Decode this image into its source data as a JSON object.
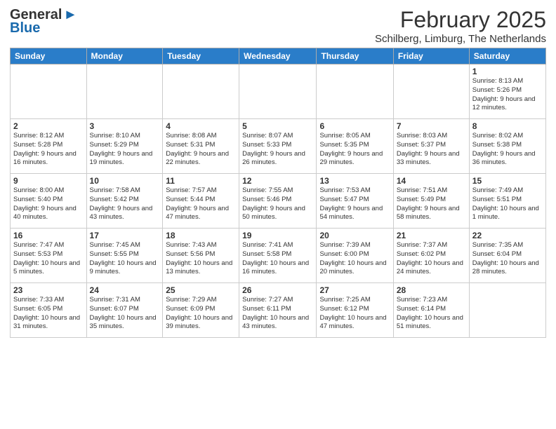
{
  "header": {
    "logo_general": "General",
    "logo_blue": "Blue",
    "title": "February 2025",
    "location": "Schilberg, Limburg, The Netherlands"
  },
  "weekdays": [
    "Sunday",
    "Monday",
    "Tuesday",
    "Wednesday",
    "Thursday",
    "Friday",
    "Saturday"
  ],
  "weeks": [
    [
      {
        "day": "",
        "info": ""
      },
      {
        "day": "",
        "info": ""
      },
      {
        "day": "",
        "info": ""
      },
      {
        "day": "",
        "info": ""
      },
      {
        "day": "",
        "info": ""
      },
      {
        "day": "",
        "info": ""
      },
      {
        "day": "1",
        "info": "Sunrise: 8:13 AM\nSunset: 5:26 PM\nDaylight: 9 hours and 12 minutes."
      }
    ],
    [
      {
        "day": "2",
        "info": "Sunrise: 8:12 AM\nSunset: 5:28 PM\nDaylight: 9 hours and 16 minutes."
      },
      {
        "day": "3",
        "info": "Sunrise: 8:10 AM\nSunset: 5:29 PM\nDaylight: 9 hours and 19 minutes."
      },
      {
        "day": "4",
        "info": "Sunrise: 8:08 AM\nSunset: 5:31 PM\nDaylight: 9 hours and 22 minutes."
      },
      {
        "day": "5",
        "info": "Sunrise: 8:07 AM\nSunset: 5:33 PM\nDaylight: 9 hours and 26 minutes."
      },
      {
        "day": "6",
        "info": "Sunrise: 8:05 AM\nSunset: 5:35 PM\nDaylight: 9 hours and 29 minutes."
      },
      {
        "day": "7",
        "info": "Sunrise: 8:03 AM\nSunset: 5:37 PM\nDaylight: 9 hours and 33 minutes."
      },
      {
        "day": "8",
        "info": "Sunrise: 8:02 AM\nSunset: 5:38 PM\nDaylight: 9 hours and 36 minutes."
      }
    ],
    [
      {
        "day": "9",
        "info": "Sunrise: 8:00 AM\nSunset: 5:40 PM\nDaylight: 9 hours and 40 minutes."
      },
      {
        "day": "10",
        "info": "Sunrise: 7:58 AM\nSunset: 5:42 PM\nDaylight: 9 hours and 43 minutes."
      },
      {
        "day": "11",
        "info": "Sunrise: 7:57 AM\nSunset: 5:44 PM\nDaylight: 9 hours and 47 minutes."
      },
      {
        "day": "12",
        "info": "Sunrise: 7:55 AM\nSunset: 5:46 PM\nDaylight: 9 hours and 50 minutes."
      },
      {
        "day": "13",
        "info": "Sunrise: 7:53 AM\nSunset: 5:47 PM\nDaylight: 9 hours and 54 minutes."
      },
      {
        "day": "14",
        "info": "Sunrise: 7:51 AM\nSunset: 5:49 PM\nDaylight: 9 hours and 58 minutes."
      },
      {
        "day": "15",
        "info": "Sunrise: 7:49 AM\nSunset: 5:51 PM\nDaylight: 10 hours and 1 minute."
      }
    ],
    [
      {
        "day": "16",
        "info": "Sunrise: 7:47 AM\nSunset: 5:53 PM\nDaylight: 10 hours and 5 minutes."
      },
      {
        "day": "17",
        "info": "Sunrise: 7:45 AM\nSunset: 5:55 PM\nDaylight: 10 hours and 9 minutes."
      },
      {
        "day": "18",
        "info": "Sunrise: 7:43 AM\nSunset: 5:56 PM\nDaylight: 10 hours and 13 minutes."
      },
      {
        "day": "19",
        "info": "Sunrise: 7:41 AM\nSunset: 5:58 PM\nDaylight: 10 hours and 16 minutes."
      },
      {
        "day": "20",
        "info": "Sunrise: 7:39 AM\nSunset: 6:00 PM\nDaylight: 10 hours and 20 minutes."
      },
      {
        "day": "21",
        "info": "Sunrise: 7:37 AM\nSunset: 6:02 PM\nDaylight: 10 hours and 24 minutes."
      },
      {
        "day": "22",
        "info": "Sunrise: 7:35 AM\nSunset: 6:04 PM\nDaylight: 10 hours and 28 minutes."
      }
    ],
    [
      {
        "day": "23",
        "info": "Sunrise: 7:33 AM\nSunset: 6:05 PM\nDaylight: 10 hours and 31 minutes."
      },
      {
        "day": "24",
        "info": "Sunrise: 7:31 AM\nSunset: 6:07 PM\nDaylight: 10 hours and 35 minutes."
      },
      {
        "day": "25",
        "info": "Sunrise: 7:29 AM\nSunset: 6:09 PM\nDaylight: 10 hours and 39 minutes."
      },
      {
        "day": "26",
        "info": "Sunrise: 7:27 AM\nSunset: 6:11 PM\nDaylight: 10 hours and 43 minutes."
      },
      {
        "day": "27",
        "info": "Sunrise: 7:25 AM\nSunset: 6:12 PM\nDaylight: 10 hours and 47 minutes."
      },
      {
        "day": "28",
        "info": "Sunrise: 7:23 AM\nSunset: 6:14 PM\nDaylight: 10 hours and 51 minutes."
      },
      {
        "day": "",
        "info": ""
      }
    ]
  ]
}
